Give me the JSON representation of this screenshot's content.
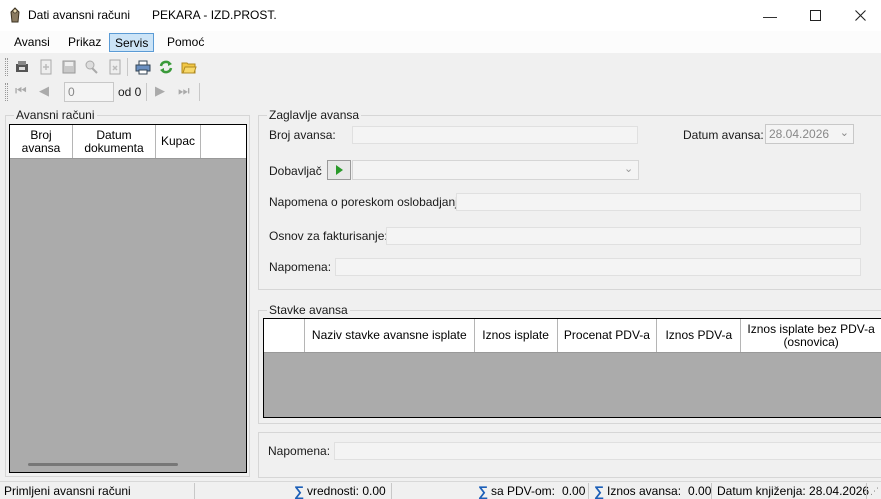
{
  "window": {
    "title": "Dati avansni računi",
    "subtitle": "PEKARA - IZD.PROST.",
    "controls": [
      "minimize-icon",
      "maximize-icon",
      "close-icon"
    ]
  },
  "menu": {
    "items": [
      "Avansi",
      "Prikaz",
      "Servis",
      "Pomoć"
    ],
    "active": "Servis"
  },
  "toolbar": {
    "icons": [
      "new-record-icon",
      "add-icon",
      "save-icon",
      "search-icon",
      "delete-icon",
      "print-icon",
      "refresh-icon",
      "folder-open-icon"
    ]
  },
  "navigator": {
    "position_value": "0",
    "of_label": "od 0"
  },
  "left_panel": {
    "title": "Avansni računi",
    "columns": [
      "Broj avansa",
      "Datum dokumenta",
      "Kupac"
    ]
  },
  "header_group": {
    "title": "Zaglavlje avansa",
    "broj_avansa_label": "Broj avansa:",
    "broj_avansa_value": "",
    "datum_avansa_label": "Datum avansa:",
    "datum_avansa_value": "28.04.2026",
    "dobavljac_label": "Dobavljač",
    "dobavljac_value": "",
    "napomena_porez_label": "Napomena o poreskom oslobadjanju:",
    "osnov_label": "Osnov za fakturisanje:",
    "napomena_label": "Napomena:"
  },
  "items_group": {
    "title": "Stavke avansa",
    "columns": [
      "Naziv stavke avansne isplate",
      "Iznos isplate",
      "Procenat PDV-a",
      "Iznos PDV-a",
      "Iznos isplate bez PDV-a (osnovica)"
    ]
  },
  "footer": {
    "napomena_label": "Napomena:"
  },
  "status": {
    "left": "Primljeni avansni računi",
    "vrednosti": "vrednosti: 0.00",
    "sa_pdv": "sa PDV-om:",
    "sa_pdv_value": "0.00",
    "iznos_avansa": "Iznos avansa:",
    "iznos_avansa_value": "0.00",
    "datum_knjizenja": "Datum knjiženja: 28.04.2026"
  },
  "colors": {
    "active_menu_bg": "#cce4f7",
    "grid_bg": "#ababab",
    "field_bg": "#f4f4f4",
    "sigma": "#1c5fb8"
  }
}
